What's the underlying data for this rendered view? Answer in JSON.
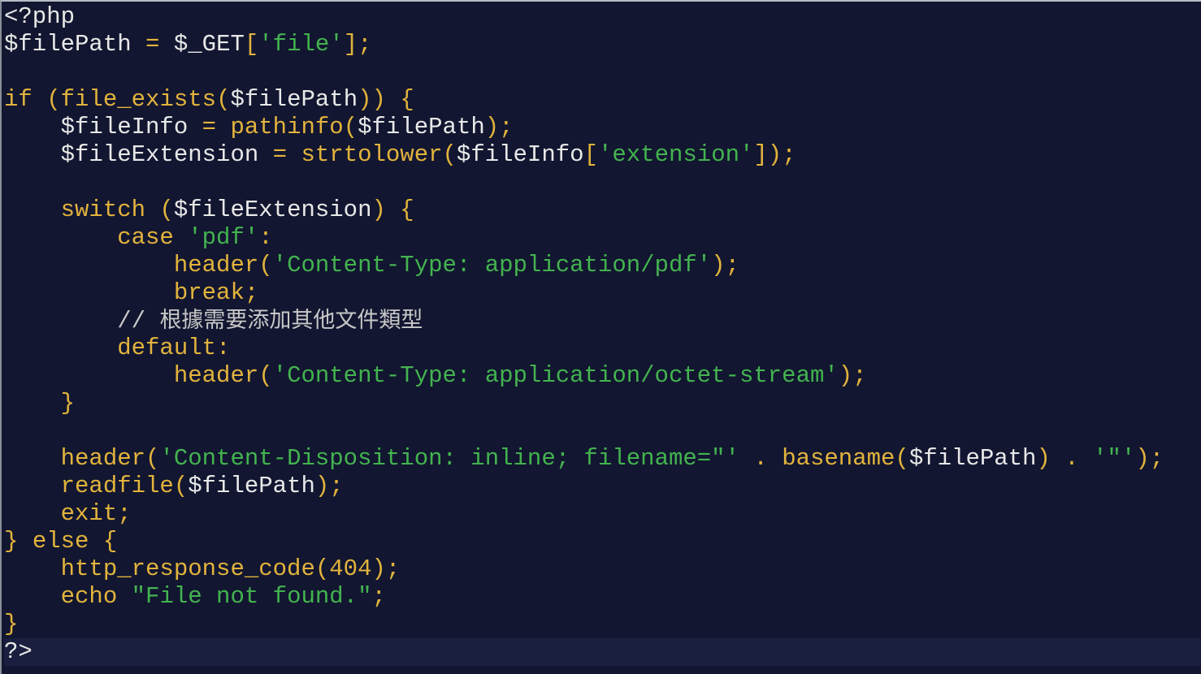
{
  "colors": {
    "background": "#121630",
    "keyword": "#e2b33d",
    "string": "#43b34f",
    "text": "#e8e8e8",
    "comment": "#c8c8c8"
  },
  "lines": [
    [
      {
        "t": "var",
        "s": "<?php"
      }
    ],
    [
      {
        "t": "var",
        "s": "$filePath"
      },
      {
        "t": "pn",
        "s": " = "
      },
      {
        "t": "var",
        "s": "$_GET"
      },
      {
        "t": "pn",
        "s": "["
      },
      {
        "t": "st",
        "s": "'file'"
      },
      {
        "t": "pn",
        "s": "];"
      }
    ],
    [],
    [
      {
        "t": "kw",
        "s": "if"
      },
      {
        "t": "pn",
        "s": " ("
      },
      {
        "t": "kw",
        "s": "file_exists"
      },
      {
        "t": "pn",
        "s": "("
      },
      {
        "t": "var",
        "s": "$filePath"
      },
      {
        "t": "pn",
        "s": ")) {"
      }
    ],
    [
      {
        "t": "var",
        "s": "    $fileInfo"
      },
      {
        "t": "pn",
        "s": " = "
      },
      {
        "t": "kw",
        "s": "pathinfo"
      },
      {
        "t": "pn",
        "s": "("
      },
      {
        "t": "var",
        "s": "$filePath"
      },
      {
        "t": "pn",
        "s": ");"
      }
    ],
    [
      {
        "t": "var",
        "s": "    $fileExtension"
      },
      {
        "t": "pn",
        "s": " = "
      },
      {
        "t": "kw",
        "s": "strtolower"
      },
      {
        "t": "pn",
        "s": "("
      },
      {
        "t": "var",
        "s": "$fileInfo"
      },
      {
        "t": "pn",
        "s": "["
      },
      {
        "t": "st",
        "s": "'extension'"
      },
      {
        "t": "pn",
        "s": "]);"
      }
    ],
    [],
    [
      {
        "t": "kw",
        "s": "    switch"
      },
      {
        "t": "pn",
        "s": " ("
      },
      {
        "t": "var",
        "s": "$fileExtension"
      },
      {
        "t": "pn",
        "s": ") {"
      }
    ],
    [
      {
        "t": "kw",
        "s": "        case"
      },
      {
        "t": "var",
        "s": " "
      },
      {
        "t": "st",
        "s": "'pdf'"
      },
      {
        "t": "pn",
        "s": ":"
      }
    ],
    [
      {
        "t": "kw",
        "s": "            header"
      },
      {
        "t": "pn",
        "s": "("
      },
      {
        "t": "st",
        "s": "'Content-Type: application/pdf'"
      },
      {
        "t": "pn",
        "s": ");"
      }
    ],
    [
      {
        "t": "kw",
        "s": "            break"
      },
      {
        "t": "pn",
        "s": ";"
      }
    ],
    [
      {
        "t": "cm",
        "s": "        // "
      },
      {
        "t": "cm cjk",
        "s": "根據需要添加其他文件類型"
      }
    ],
    [
      {
        "t": "kw",
        "s": "        default"
      },
      {
        "t": "pn",
        "s": ":"
      }
    ],
    [
      {
        "t": "kw",
        "s": "            header"
      },
      {
        "t": "pn",
        "s": "("
      },
      {
        "t": "st",
        "s": "'Content-Type: application/octet-stream'"
      },
      {
        "t": "pn",
        "s": ");"
      }
    ],
    [
      {
        "t": "pn",
        "s": "    }"
      }
    ],
    [],
    [
      {
        "t": "kw",
        "s": "    header"
      },
      {
        "t": "pn",
        "s": "("
      },
      {
        "t": "st",
        "s": "'Content-Disposition: inline; filename=\"'"
      },
      {
        "t": "pn",
        "s": " . "
      },
      {
        "t": "kw",
        "s": "basename"
      },
      {
        "t": "pn",
        "s": "("
      },
      {
        "t": "var",
        "s": "$filePath"
      },
      {
        "t": "pn",
        "s": ") . "
      },
      {
        "t": "st",
        "s": "'\"'"
      },
      {
        "t": "pn",
        "s": ");"
      }
    ],
    [
      {
        "t": "kw",
        "s": "    readfile"
      },
      {
        "t": "pn",
        "s": "("
      },
      {
        "t": "var",
        "s": "$filePath"
      },
      {
        "t": "pn",
        "s": ");"
      }
    ],
    [
      {
        "t": "kw",
        "s": "    exit"
      },
      {
        "t": "pn",
        "s": ";"
      }
    ],
    [
      {
        "t": "pn",
        "s": "} "
      },
      {
        "t": "kw",
        "s": "else"
      },
      {
        "t": "pn",
        "s": " {"
      }
    ],
    [
      {
        "t": "kw",
        "s": "    http_response_code"
      },
      {
        "t": "pn",
        "s": "(404);"
      }
    ],
    [
      {
        "t": "kw",
        "s": "    echo"
      },
      {
        "t": "var",
        "s": " "
      },
      {
        "t": "st",
        "s": "\"File not found.\""
      },
      {
        "t": "pn",
        "s": ";"
      }
    ],
    [
      {
        "t": "pn",
        "s": "}"
      }
    ],
    [
      {
        "t": "var",
        "s": "?>"
      }
    ]
  ],
  "current_line": 23
}
